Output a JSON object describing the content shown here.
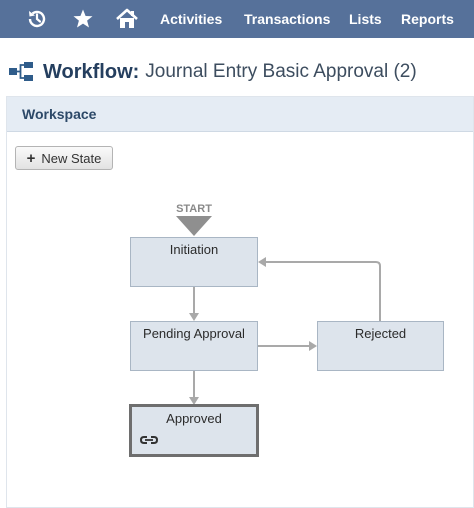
{
  "nav": {
    "icons": [
      "history-icon",
      "star-icon",
      "home-icon"
    ],
    "links": [
      "Activities",
      "Transactions",
      "Lists",
      "Reports"
    ]
  },
  "header": {
    "title_strong": "Workflow:",
    "title_rest": "Journal Entry Basic Approval (2)"
  },
  "workspace": {
    "title": "Workspace",
    "new_state_label": "New State",
    "start_label": "START",
    "states": {
      "initiation": "Initiation",
      "pending": "Pending Approval",
      "rejected": "Rejected",
      "approved": "Approved"
    }
  },
  "colors": {
    "nav_bg": "#56719a",
    "state_fill": "#dde4ec",
    "panel_header": "#e5ecf4"
  }
}
